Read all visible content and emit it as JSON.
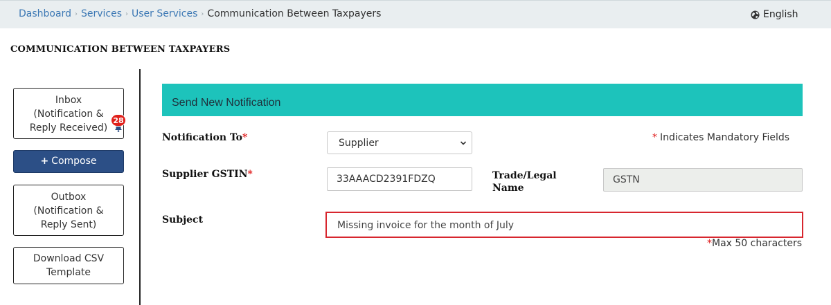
{
  "breadcrumb": {
    "items": [
      "Dashboard",
      "Services",
      "User Services"
    ],
    "current": "Communication Between Taxpayers"
  },
  "language": {
    "label": "English",
    "icon": "globe-icon"
  },
  "page_title": "COMMUNICATION BETWEEN TAXPAYERS",
  "sidebar": {
    "inbox": {
      "lines": [
        "Inbox",
        "(Notification &",
        "Reply Received)"
      ],
      "badge": "28",
      "icon": "bell-icon"
    },
    "compose": {
      "label": "Compose",
      "icon": "plus-icon"
    },
    "outbox": {
      "lines": [
        "Outbox",
        "(Notification &",
        "Reply Sent)"
      ]
    },
    "csv": {
      "lines": [
        "Download CSV",
        "Template"
      ]
    }
  },
  "form": {
    "header": "Send New Notification",
    "mandatory_note": "Indicates Mandatory Fields",
    "required_mark": "*",
    "notification_to": {
      "label": "Notification To",
      "value": "Supplier"
    },
    "supplier_gstin": {
      "label": "Supplier GSTIN",
      "value": "33AAACD2391FDZQ"
    },
    "trade_name": {
      "label_line1": "Trade/Legal",
      "label_line2": "Name",
      "value": "GSTN"
    },
    "subject": {
      "label": "Subject",
      "value": "Missing invoice for the month of July"
    },
    "max_chars": "Max 50 characters"
  },
  "colors": {
    "accent_header": "#1dc3bb",
    "compose_button": "#2c4f86",
    "required": "#e02020",
    "highlight_border": "#d7262e",
    "link": "#3c78b4"
  }
}
